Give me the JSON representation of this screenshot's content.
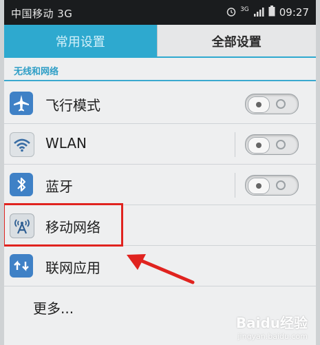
{
  "status_bar": {
    "carrier": "中国移动 3G",
    "network": "3G",
    "time": "09:27"
  },
  "tabs": [
    {
      "label": "常用设置",
      "selected": false
    },
    {
      "label": "全部设置",
      "selected": true
    }
  ],
  "section": {
    "title": "无线和网络"
  },
  "rows": [
    {
      "label": "飞行模式",
      "icon": "airplane-icon",
      "toggle": "off"
    },
    {
      "label": "WLAN",
      "icon": "wifi-icon",
      "toggle": "off"
    },
    {
      "label": "蓝牙",
      "icon": "bluetooth-icon",
      "toggle": "off"
    },
    {
      "label": "移动网络",
      "icon": "antenna-icon"
    },
    {
      "label": "联网应用",
      "icon": "sync-icon"
    },
    {
      "label": "更多..."
    }
  ],
  "watermark": {
    "brand": "Baidu经验",
    "url": "jingyan.baidu.com"
  },
  "colors": {
    "accent": "#2ea9cf",
    "highlight": "#e0231f",
    "icon_blue": "#3f81c6"
  }
}
